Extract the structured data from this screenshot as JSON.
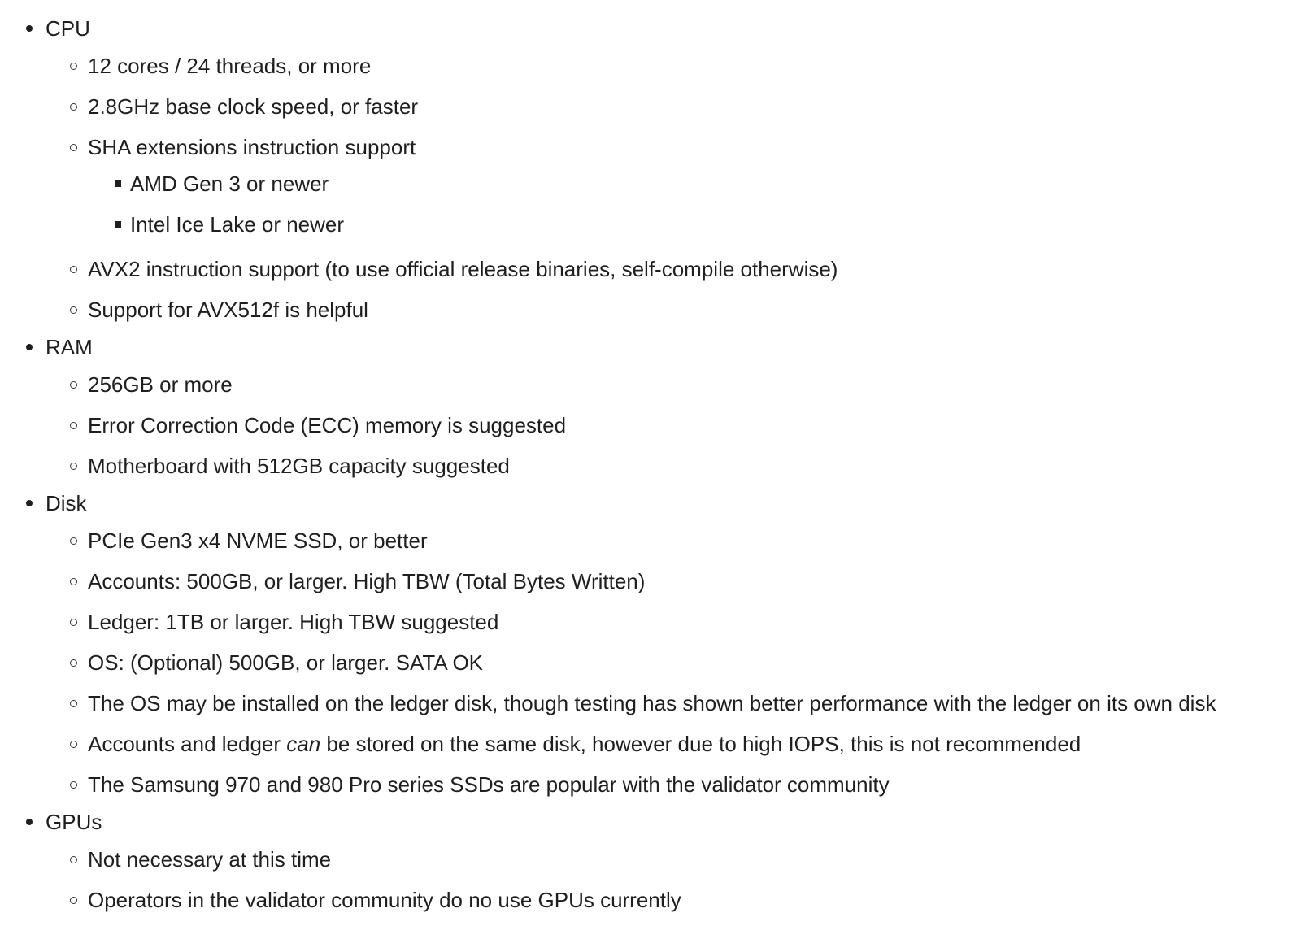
{
  "sections": [
    {
      "label": "CPU",
      "items": [
        {
          "text": "12 cores / 24 threads, or more"
        },
        {
          "text": "2.8GHz base clock speed, or faster"
        },
        {
          "text": "SHA extensions instruction support",
          "subitems": [
            "AMD Gen 3 or newer",
            "Intel Ice Lake or newer"
          ]
        },
        {
          "text": "AVX2 instruction support (to use official release binaries, self-compile otherwise)"
        },
        {
          "text": "Support for AVX512f is helpful"
        }
      ]
    },
    {
      "label": "RAM",
      "items": [
        {
          "text": "256GB or more"
        },
        {
          "text": "Error Correction Code (ECC) memory is suggested"
        },
        {
          "text": "Motherboard with 512GB capacity suggested"
        }
      ]
    },
    {
      "label": "Disk",
      "items": [
        {
          "text": "PCIe Gen3 x4 NVME SSD, or better"
        },
        {
          "text": "Accounts: 500GB, or larger. High TBW (Total Bytes Written)"
        },
        {
          "text": "Ledger: 1TB or larger. High TBW suggested"
        },
        {
          "text": "OS: (Optional) 500GB, or larger. SATA OK"
        },
        {
          "text": "The OS may be installed on the ledger disk, though testing has shown better performance with the ledger on its own disk"
        },
        {
          "text_before": "Accounts and ledger ",
          "text_em": "can",
          "text_after": " be stored on the same disk, however due to high IOPS, this is not recommended"
        },
        {
          "text": "The Samsung 970 and 980 Pro series SSDs are popular with the validator community"
        }
      ]
    },
    {
      "label": "GPUs",
      "items": [
        {
          "text": "Not necessary at this time"
        },
        {
          "text": "Operators in the validator community do no use GPUs currently"
        }
      ]
    }
  ]
}
